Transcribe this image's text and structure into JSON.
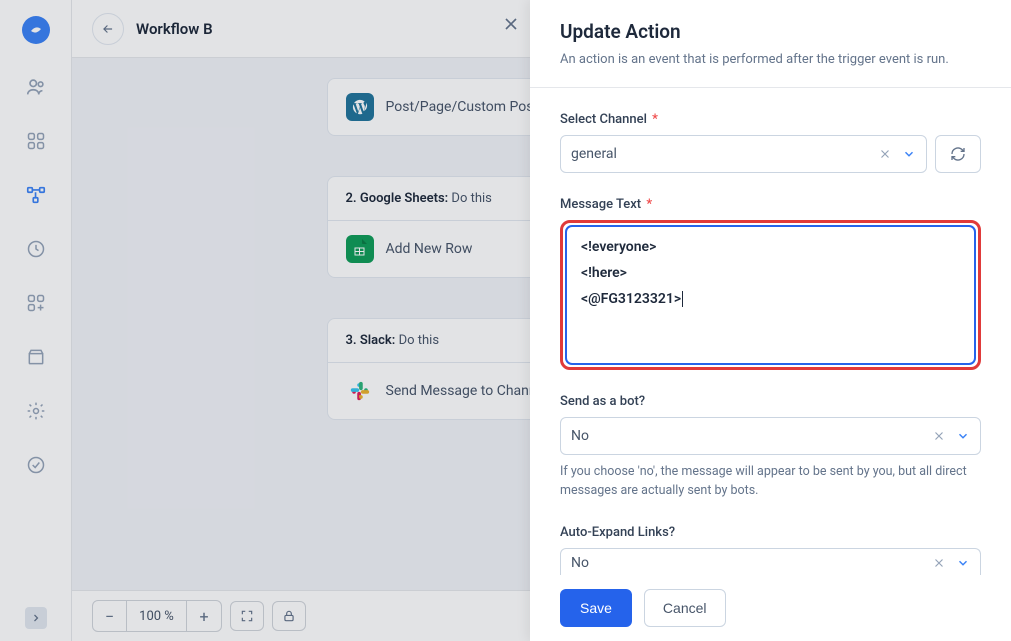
{
  "topbar": {
    "title": "Workflow B"
  },
  "zoom": {
    "value": "100 %"
  },
  "nodes": {
    "wp": {
      "label": "Post/Page/Custom Post Type"
    },
    "gsheets": {
      "header_prefix": "2. Google Sheets:",
      "header_suffix": " Do this",
      "label": "Add New Row"
    },
    "slack": {
      "header_prefix": "3. Slack:",
      "header_suffix": " Do this",
      "label": "Send Message to Channel"
    }
  },
  "panel": {
    "title": "Update Action",
    "subtitle": "An action is an event that is performed after the trigger event is run.",
    "channel": {
      "label": "Select Channel",
      "required": "*",
      "value": "general"
    },
    "message": {
      "label": "Message Text",
      "required": "*",
      "line1": "<!everyone>",
      "line2": "<!here>",
      "line3": "<@FG3123321>"
    },
    "bot": {
      "label": "Send as a bot?",
      "value": "No",
      "help": "If you choose 'no', the message will appear to be sent by you, but all direct messages are actually sent by bots."
    },
    "autoexpand": {
      "label": "Auto-Expand Links?",
      "value": "No"
    },
    "save": "Save",
    "cancel": "Cancel"
  }
}
